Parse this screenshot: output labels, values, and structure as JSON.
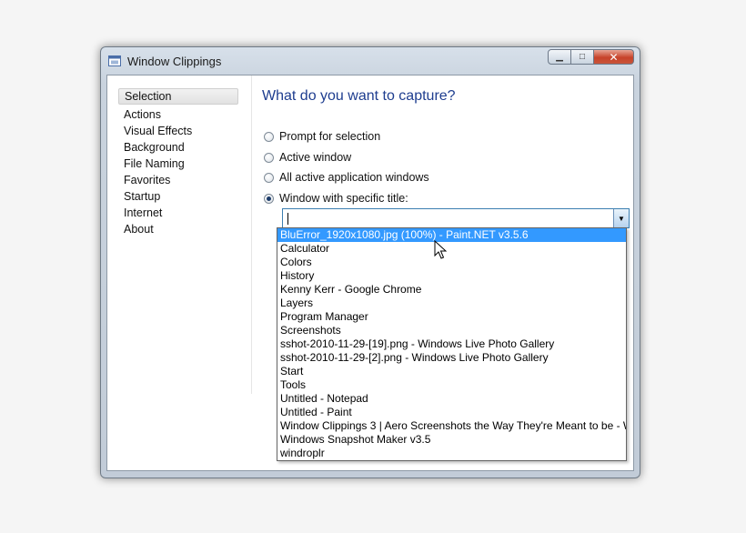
{
  "window": {
    "title": "Window Clippings",
    "buttons": {
      "minimize": "▁",
      "maximize": "□",
      "close": "✕"
    }
  },
  "sidebar": {
    "items": [
      {
        "label": "Selection",
        "selected": true
      },
      {
        "label": "Actions"
      },
      {
        "label": "Visual Effects"
      },
      {
        "label": "Background"
      },
      {
        "label": "File Naming"
      },
      {
        "label": "Favorites"
      },
      {
        "label": "Startup"
      },
      {
        "label": "Internet"
      },
      {
        "label": "About"
      }
    ]
  },
  "main": {
    "heading": "What do you want to capture?",
    "options": [
      {
        "label": "Prompt for selection",
        "checked": false
      },
      {
        "label": "Active window",
        "checked": false
      },
      {
        "label": "All active application windows",
        "checked": false
      },
      {
        "label": "Window with specific title:",
        "checked": true
      }
    ],
    "combo": {
      "value": ""
    }
  },
  "dropdown": {
    "items": [
      "BluError_1920x1080.jpg (100%) - Paint.NET v3.5.6",
      "Calculator",
      "Colors",
      "History",
      "Kenny Kerr - Google Chrome",
      "Layers",
      "Program Manager",
      "Screenshots",
      "sshot-2010-11-29-[19].png - Windows Live Photo Gallery",
      "sshot-2010-11-29-[2].png - Windows Live Photo Gallery",
      "Start",
      "Tools",
      "Untitled - Notepad",
      "Untitled - Paint",
      "Window Clippings 3 | Aero Screenshots the Way They're Meant to be - W",
      "Windows Snapshot Maker v3.5",
      "windroplr"
    ],
    "highlighted_index": 0
  },
  "colors": {
    "heading": "#1e3d8f",
    "highlight": "#3399ff",
    "close_button": "#c7432a"
  }
}
